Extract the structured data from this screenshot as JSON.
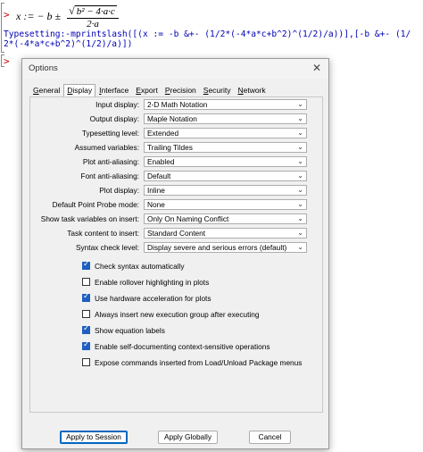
{
  "worksheet": {
    "prompt_symbol": ">",
    "math_lhs": "x := − b ±",
    "math_sqrt": "b² − 4·a·c",
    "math_den": "2·a",
    "code_lines": [
      "Typesetting:-mprintslash([(x := -b &+- (1/2*(-4*a*c+b^2)^(1/2)/a))],[-b &+- (1/",
      "2*(-4*a*c+b^2)^(1/2)/a)])"
    ]
  },
  "dialog": {
    "title": "Options",
    "close_glyph": "✕",
    "tabs": [
      {
        "label": "General",
        "underline": "G",
        "rest": "eneral"
      },
      {
        "label": "Display",
        "underline": "D",
        "rest": "isplay",
        "active": true
      },
      {
        "label": "Interface",
        "underline": "I",
        "rest": "nterface"
      },
      {
        "label": "Export",
        "underline": "E",
        "rest": "xport"
      },
      {
        "label": "Precision",
        "underline": "P",
        "rest": "recision"
      },
      {
        "label": "Security",
        "underline": "S",
        "rest": "ecurity"
      },
      {
        "label": "Network",
        "underline": "N",
        "rest": "etwork"
      }
    ],
    "settings": [
      {
        "label": "Input display:",
        "value": "2-D Math Notation"
      },
      {
        "label": "Output display:",
        "value": "Maple Notation"
      },
      {
        "label": "Typesetting level:",
        "value": "Extended"
      },
      {
        "label": "Assumed variables:",
        "value": "Trailing Tildes"
      },
      {
        "label": "Plot anti-aliasing:",
        "value": "Enabled"
      },
      {
        "label": "Font anti-aliasing:",
        "value": "Default"
      },
      {
        "label": "Plot display:",
        "value": "Inline"
      },
      {
        "label": "Default Point Probe mode:",
        "value": "None"
      },
      {
        "label": "Show task variables on insert:",
        "value": "Only On Naming Conflict"
      },
      {
        "label": "Task content to insert:",
        "value": "Standard Content"
      },
      {
        "label": "Syntax check level:",
        "value": "Display severe and serious errors (default)"
      }
    ],
    "checkboxes": [
      {
        "label": "Check syntax automatically",
        "checked": true
      },
      {
        "label": "Enable rollover highlighting in plots",
        "checked": false
      },
      {
        "label": "Use hardware acceleration for plots",
        "checked": true
      },
      {
        "label": "Always insert new execution group after executing",
        "checked": false
      },
      {
        "label": "Show equation labels",
        "checked": true
      },
      {
        "label": "Enable self-documenting context-sensitive operations",
        "checked": true
      },
      {
        "label": "Expose commands inserted from Load/Unload Package menus",
        "checked": false
      }
    ],
    "buttons": {
      "apply_session": "Apply to Session",
      "apply_globally": "Apply Globally",
      "cancel": "Cancel"
    },
    "dropdown_chevron": "⌄"
  }
}
